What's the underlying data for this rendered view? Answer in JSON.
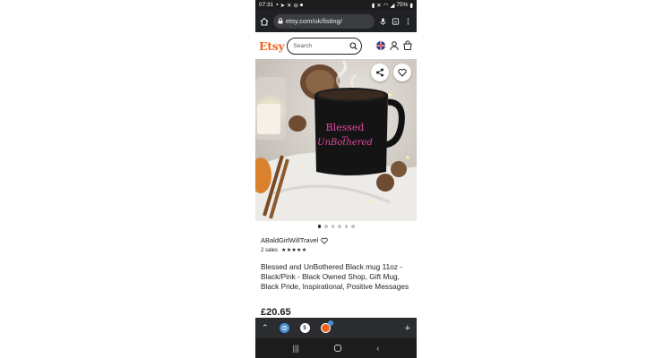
{
  "status_bar": {
    "time": "07:31",
    "battery": "75%"
  },
  "browser": {
    "url": "etsy.com/uk/listing/"
  },
  "etsy_header": {
    "logo": "Etsy",
    "search_placeholder": "Search"
  },
  "product": {
    "mug_text_line1": "Blessed",
    "mug_text_line2": "and",
    "mug_text_line3": "UnBothered",
    "shop_name": "ABaldGirlWillTravel",
    "sales": "2 sales",
    "stars": "★★★★★",
    "title": "Blessed and UnBothered Black mug 11oz - Black/Pink - Black Owned Shop, Gift Mug, Black Pride, Inspirational, Positive Messages",
    "price": "£20.65"
  },
  "carousel": {
    "count": 6,
    "active_index": 0
  },
  "tabbar": {
    "tab_count": "5"
  },
  "colors": {
    "etsy_orange": "#f1641e",
    "mug_text_pink": "#e0479e",
    "chrome_dark": "#202124"
  }
}
